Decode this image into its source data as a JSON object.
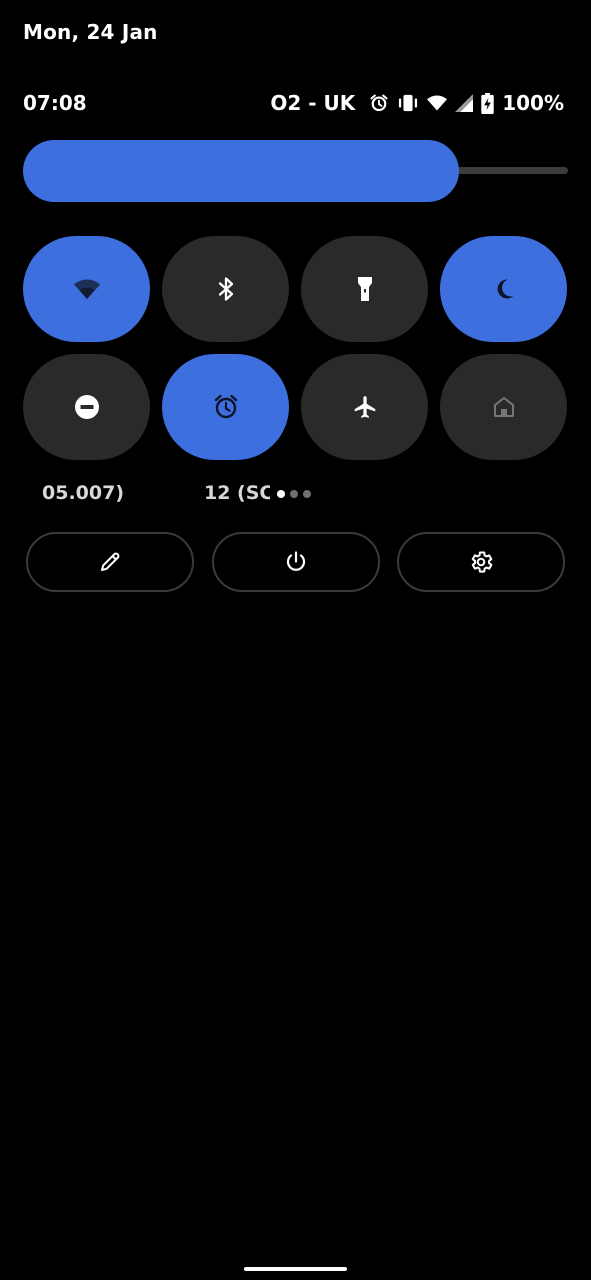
{
  "header": {
    "date": "Mon, 24 Jan"
  },
  "status_bar": {
    "time": "07:08",
    "carrier": "O2 - UK",
    "battery": "100%",
    "icons": [
      "alarm-icon",
      "vibrate-icon",
      "wifi-icon",
      "cell-signal-icon",
      "battery-charging-icon"
    ]
  },
  "brightness": {
    "level": 0.8
  },
  "quick_tiles": [
    {
      "icon": "wifi-icon",
      "active": true
    },
    {
      "icon": "bluetooth-icon",
      "active": false
    },
    {
      "icon": "flashlight-icon",
      "active": false
    },
    {
      "icon": "night-light-icon",
      "active": true
    },
    {
      "icon": "do-not-disturb-icon",
      "active": false
    },
    {
      "icon": "alarm-icon",
      "active": true
    },
    {
      "icon": "airplane-icon",
      "active": false
    },
    {
      "icon": "home-icon",
      "active": false,
      "disabled": true
    }
  ],
  "tile_labels": {
    "label_1": "05.007)",
    "label_2": "12 (SC"
  },
  "pager": {
    "pages": 3,
    "current": 1
  },
  "footer": {
    "buttons": [
      "edit-icon",
      "power-icon",
      "settings-icon"
    ]
  },
  "colors": {
    "accent": "#3d6fde",
    "tile_off": "#2a2a2a",
    "background": "#000000"
  }
}
